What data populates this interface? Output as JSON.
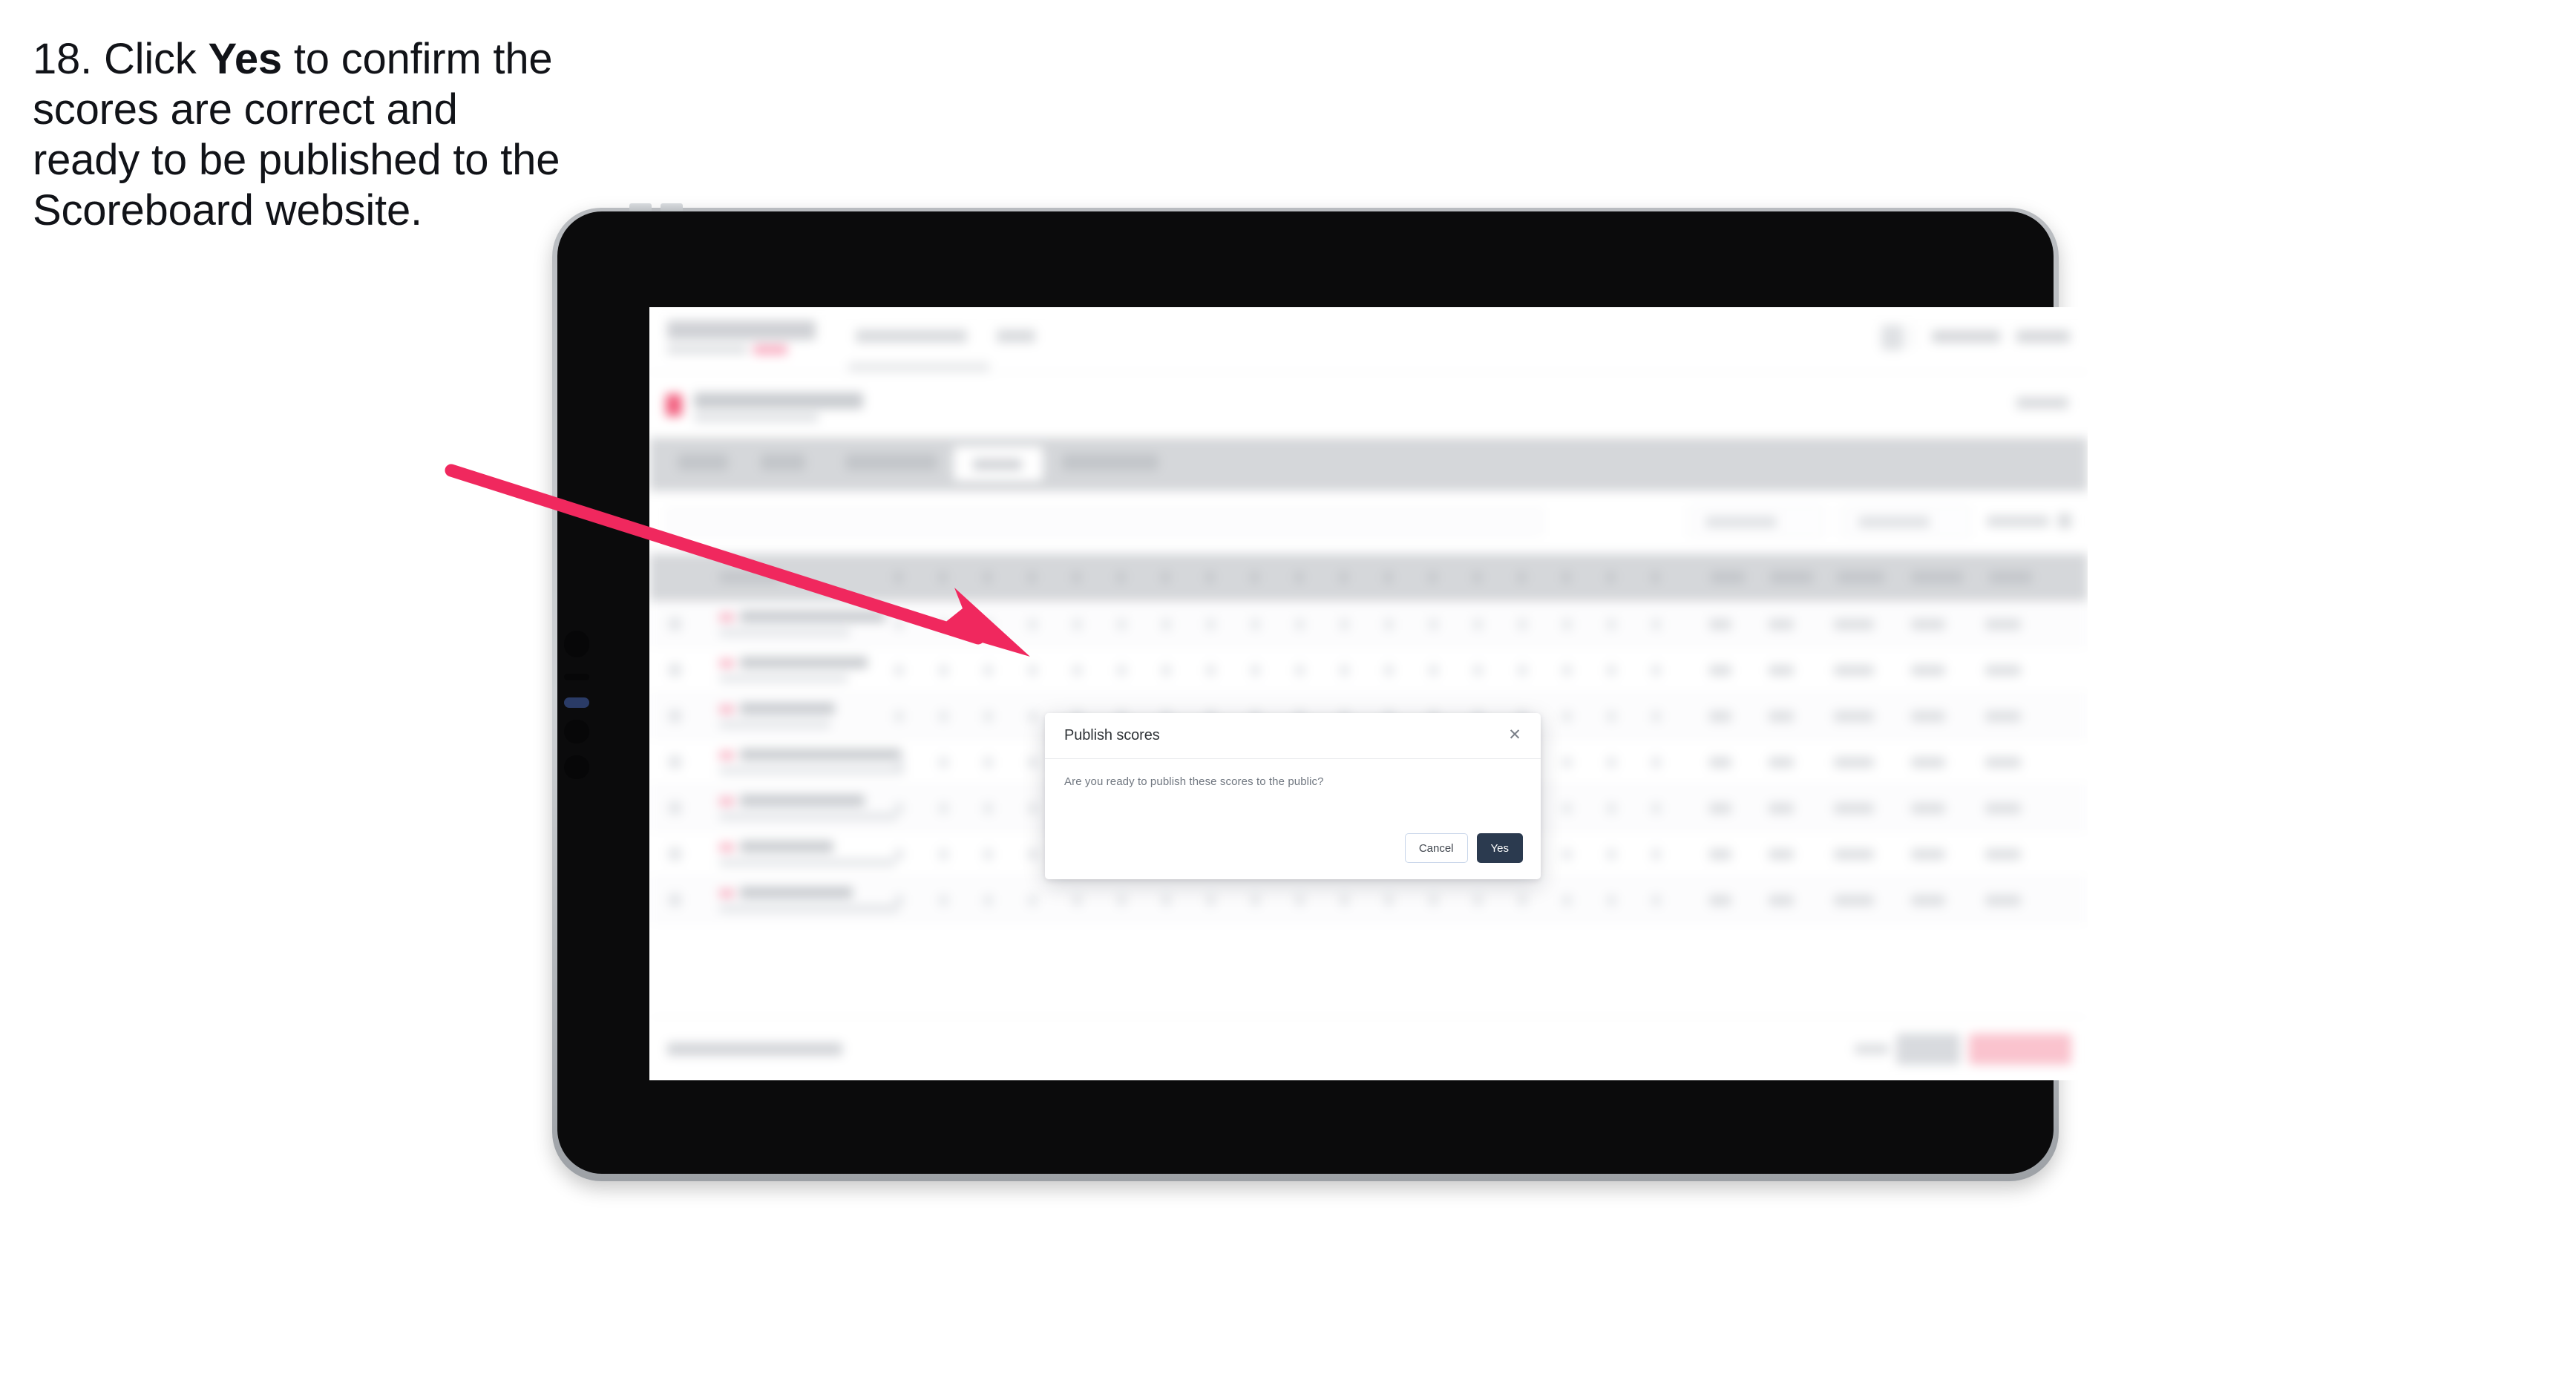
{
  "instruction": {
    "number": "18.",
    "text_before": "Click",
    "emphasis": "Yes",
    "text_after": "to confirm the scores are correct and ready to be published to the Scoreboard website.",
    "full": "18. Click Yes to confirm the scores are correct and ready to be published to the Scoreboard website."
  },
  "device": {
    "type": "tablet",
    "orientation": "landscape"
  },
  "modal": {
    "title": "Publish scores",
    "body": "Are you ready to publish these scores to the public?",
    "close_icon": "close-icon",
    "close_glyph": "✕",
    "cancel_label": "Cancel",
    "confirm_label": "Yes"
  },
  "colors": {
    "arrow": "#F0285E",
    "confirm_button_bg": "#2B3A4F",
    "confirm_button_text": "#FFFFFF",
    "cancel_button_border": "#C9D6EA",
    "modal_bg": "#FFFFFF",
    "modal_title_text": "#2F3337",
    "modal_body_text": "#707780",
    "device_bezel": "#0B0B0C",
    "device_frame": "#C0C3C7",
    "instruction_text": "#111318",
    "app_tabbar_bg": "#D5D7DA"
  },
  "annotation": {
    "arrow_name": "callout-arrow",
    "points_to": "Yes button"
  }
}
